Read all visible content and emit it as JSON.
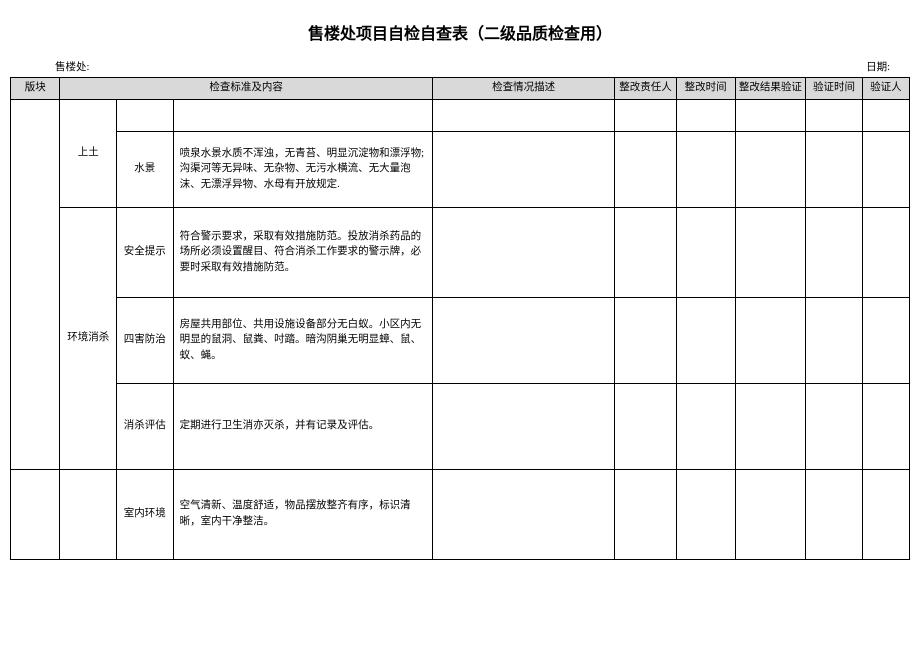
{
  "title": "售楼处项目自检自查表（二级品质检查用）",
  "meta": {
    "left_label": "售楼处:",
    "right_label": "日期:"
  },
  "headers": {
    "block": "版块",
    "standard": "检查标准及内容",
    "desc": "检查情况描述",
    "person": "整改责任人",
    "time": "整改时间",
    "result": "整改结果验证",
    "vtime": "验证时间",
    "vperson": "验证人"
  },
  "rows": [
    {
      "cat1": "",
      "cat2": "上土",
      "cat3": "",
      "content": ""
    },
    {
      "cat1": "",
      "cat2": "",
      "cat3": "水景",
      "content": "喷泉水景水质不浑浊，无青苔、明显沉淀物和漂浮物;沟渠河等无异味、无杂物、无污水横流、无大量泡沫、无漂浮异物、水母有开放规定."
    },
    {
      "cat1": "环境消杀",
      "cat2": "",
      "cat3": "安全提示",
      "content": "符合警示要求，采取有效措施防范。投放消杀药品的场所必须设置醒目、符合消杀工作要求的警示牌，必要时采取有效措施防范。"
    },
    {
      "cat1": "",
      "cat2": "",
      "cat3": "四害防治",
      "content": "房屋共用部位、共用设施设备部分无白蚁。小区内无明显的鼠洞、鼠粪、吋踏。暗沟阴巢无明显蟑、鼠、蚁、蝇。"
    },
    {
      "cat1": "",
      "cat2": "",
      "cat3": "消杀评估",
      "content": "定期进行卫生消亦灭杀，并有记录及评估。"
    },
    {
      "cat1": "",
      "cat2": "",
      "cat3": "室内环境",
      "content": "空气清新、温度舒适，物品摆放整齐有序，标识清晰，室内干净整洁。"
    }
  ]
}
